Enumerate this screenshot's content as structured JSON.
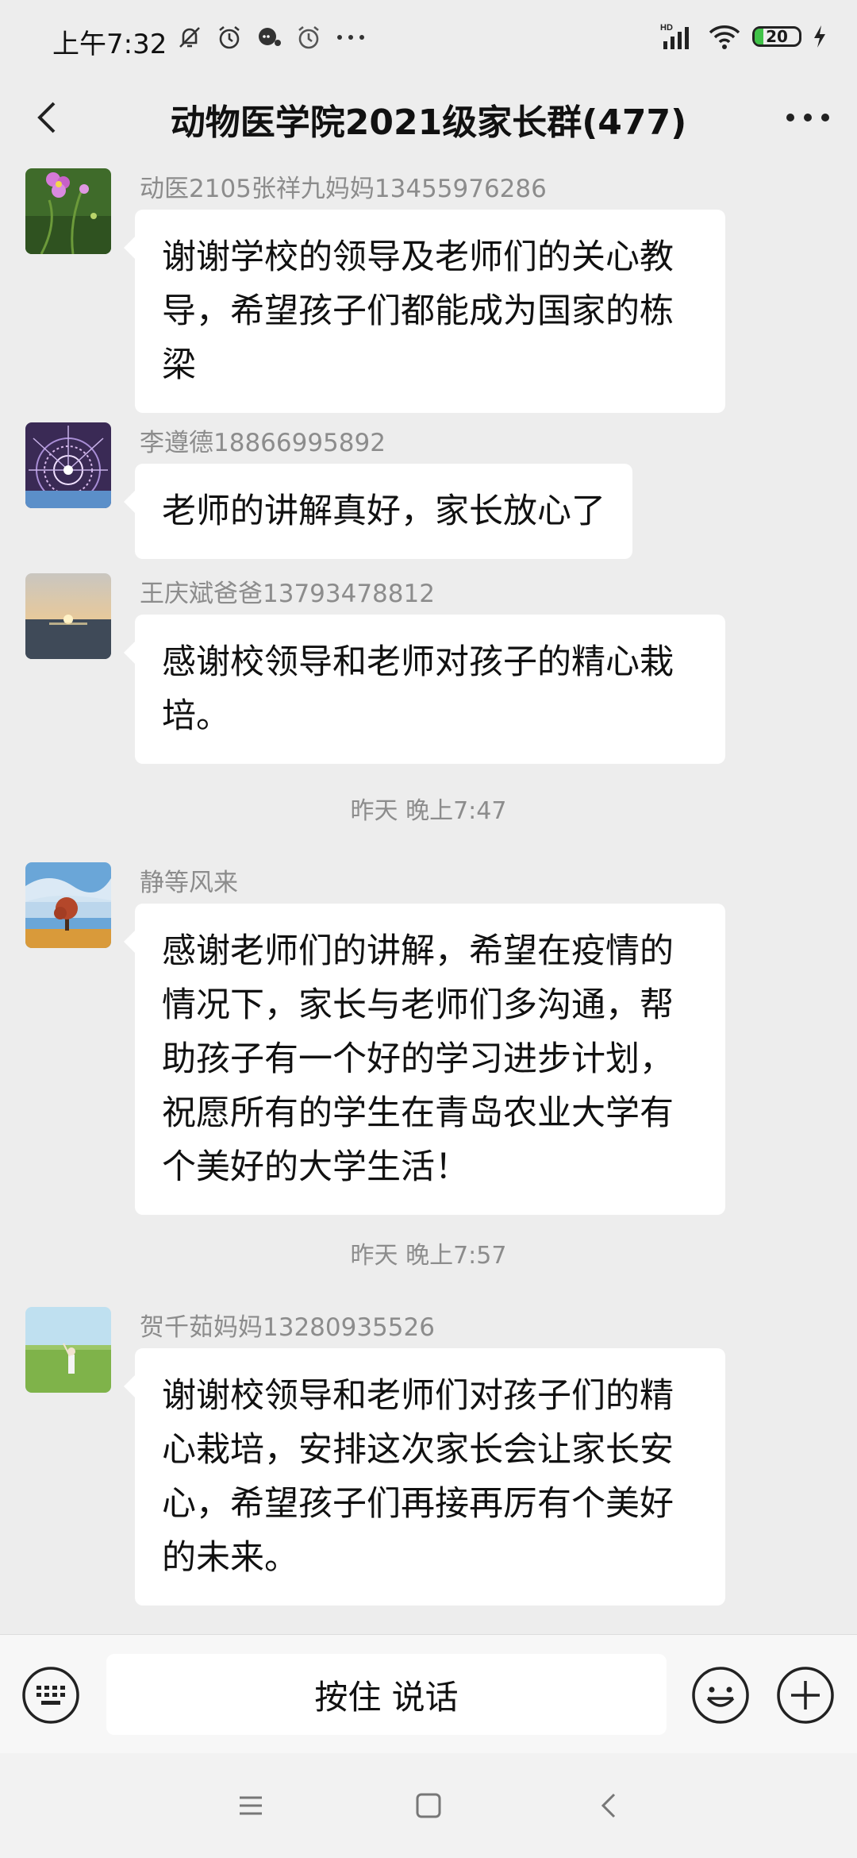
{
  "status_bar": {
    "time": "上午7:32",
    "left_icons": [
      "bell-off-icon",
      "alarm-icon",
      "chat-bubble-icon",
      "alarm-icon-2",
      "more-dots-icon"
    ],
    "network": "HD",
    "battery": "20",
    "battery_level": 0.2
  },
  "header": {
    "title": "动物医学院2021级家长群(477)",
    "back_icon": "chevron-left-icon",
    "more_icon": "more-horizontal-icon"
  },
  "messages": [
    {
      "sender": "动医2105张祥九妈妈13455976286",
      "lines": [
        "谢谢学校的领导及老师们的关心教",
        "导，希望孩子们都能成为国家的栋",
        "梁"
      ],
      "avatar": "flower"
    },
    {
      "sender": "李遵德18866995892",
      "lines": [
        "老师的讲解真好，家长放心了"
      ],
      "avatar": "fireworks"
    },
    {
      "sender": "王庆斌爸爸13793478812",
      "lines": [
        "感谢校领导和老师对孩子的精心栽",
        "培。"
      ],
      "avatar": "sunset"
    }
  ],
  "timestamp_1": "昨天 晚上7:47",
  "message_4": {
    "sender": "静等风来",
    "lines": [
      "感谢老师们的讲解，希望在疫情的",
      "情况下，家长与老师们多沟通，帮",
      "助孩子有一个好的学习进步计划，",
      "祝愿所有的学生在青岛农业大学有",
      "个美好的大学生活！"
    ],
    "avatar": "tree"
  },
  "timestamp_2": "昨天 晚上7:57",
  "message_5": {
    "sender": "贺千茹妈妈13280935526",
    "lines": [
      "谢谢校领导和老师们对孩子们的精",
      "心栽培，安排这次家长会让家长安",
      "心，希望孩子们再接再厉有个美好",
      "的未来。"
    ],
    "avatar": "meadow"
  },
  "input_bar": {
    "voice_label": "按住 说话",
    "keyboard_icon": "keyboard-icon",
    "emoji_icon": "emoji-icon",
    "plus_icon": "plus-circle-icon"
  },
  "colors": {
    "background": "#ededed",
    "bubble": "#ffffff",
    "sender_text": "#8c8c8c",
    "battery_green": "#40c248"
  }
}
